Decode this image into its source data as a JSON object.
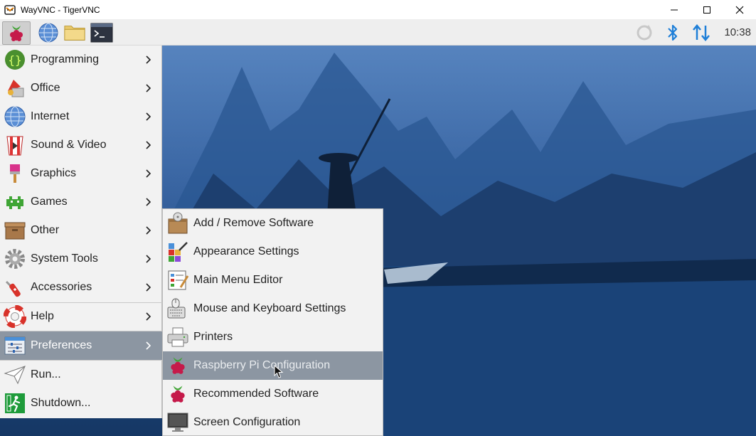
{
  "window": {
    "title": "WayVNC - TigerVNC"
  },
  "taskbar": {
    "clock": "10:38"
  },
  "main_menu": {
    "items": [
      {
        "label": "Programming",
        "icon": "code-braces-icon"
      },
      {
        "label": "Office",
        "icon": "office-icon"
      },
      {
        "label": "Internet",
        "icon": "globe-icon"
      },
      {
        "label": "Sound & Video",
        "icon": "popcorn-icon"
      },
      {
        "label": "Graphics",
        "icon": "paintbrush-icon"
      },
      {
        "label": "Games",
        "icon": "space-invader-icon"
      },
      {
        "label": "Other",
        "icon": "box-icon"
      },
      {
        "label": "System Tools",
        "icon": "gear-icon"
      },
      {
        "label": "Accessories",
        "icon": "swiss-knife-icon"
      },
      {
        "label": "Help",
        "icon": "lifebuoy-icon"
      },
      {
        "label": "Preferences",
        "icon": "sliders-icon"
      },
      {
        "label": "Run...",
        "icon": "paper-plane-icon"
      },
      {
        "label": "Shutdown...",
        "icon": "exit-icon"
      }
    ]
  },
  "preferences_menu": {
    "items": [
      {
        "label": "Add / Remove Software",
        "icon": "package-icon"
      },
      {
        "label": "Appearance Settings",
        "icon": "palette-icon"
      },
      {
        "label": "Main Menu Editor",
        "icon": "menu-editor-icon"
      },
      {
        "label": "Mouse and Keyboard Settings",
        "icon": "keyboard-mouse-icon"
      },
      {
        "label": "Printers",
        "icon": "printer-icon"
      },
      {
        "label": "Raspberry Pi Configuration",
        "icon": "raspberry-icon"
      },
      {
        "label": "Recommended Software",
        "icon": "raspberry-icon"
      },
      {
        "label": "Screen Configuration",
        "icon": "monitor-icon"
      }
    ]
  },
  "colors": {
    "highlight": "#8c96a2",
    "menu_bg": "#f2f2f2",
    "desktop_blue": "#2e5b9b"
  }
}
